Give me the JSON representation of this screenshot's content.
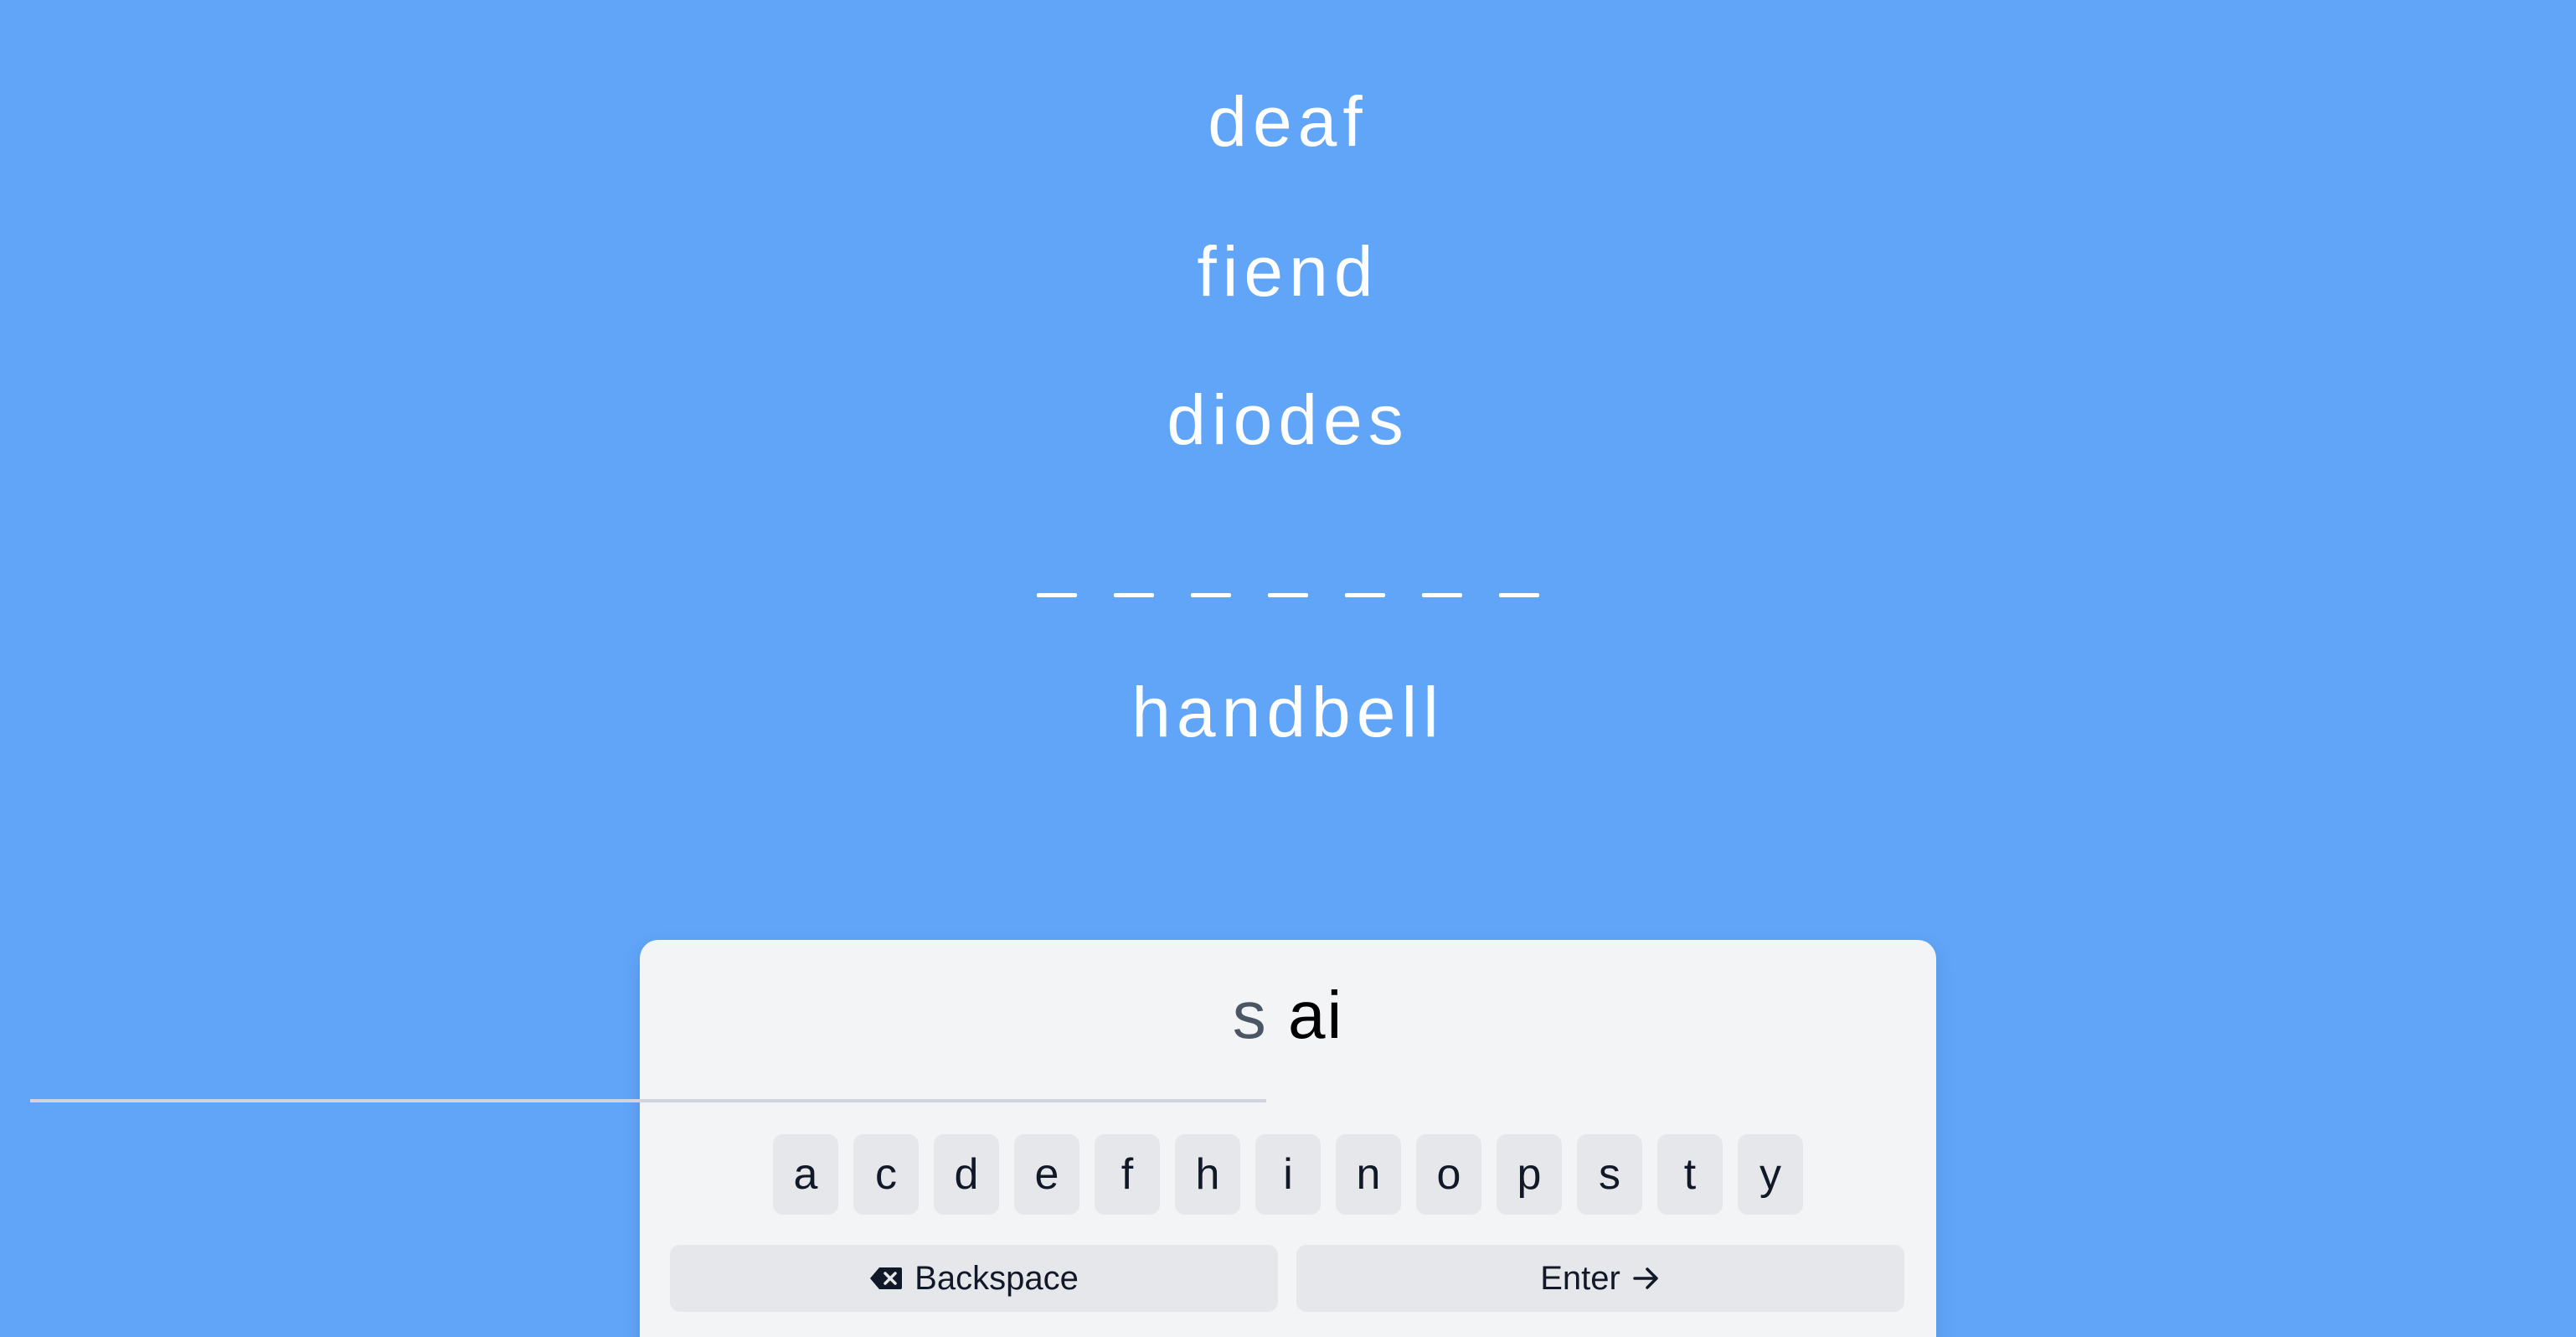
{
  "clues": [
    "deaf",
    "fiend",
    "diodes"
  ],
  "answer_blanks": 7,
  "next_word": "handbell",
  "input": {
    "prefix": "s",
    "typed": "ai"
  },
  "keyboard": {
    "letters": [
      "a",
      "c",
      "d",
      "e",
      "f",
      "h",
      "i",
      "n",
      "o",
      "p",
      "s",
      "t",
      "y"
    ],
    "backspace_label": "Backspace",
    "enter_label": "Enter"
  },
  "icons": {
    "backspace": "backspace-icon",
    "enter": "arrow-right-icon"
  },
  "colors": {
    "background": "#60a5f8",
    "panel": "#f3f4f6",
    "key": "#e5e7eb",
    "text_light": "#ffffff",
    "text_dark": "#111827",
    "prefix": "#4b5563"
  }
}
